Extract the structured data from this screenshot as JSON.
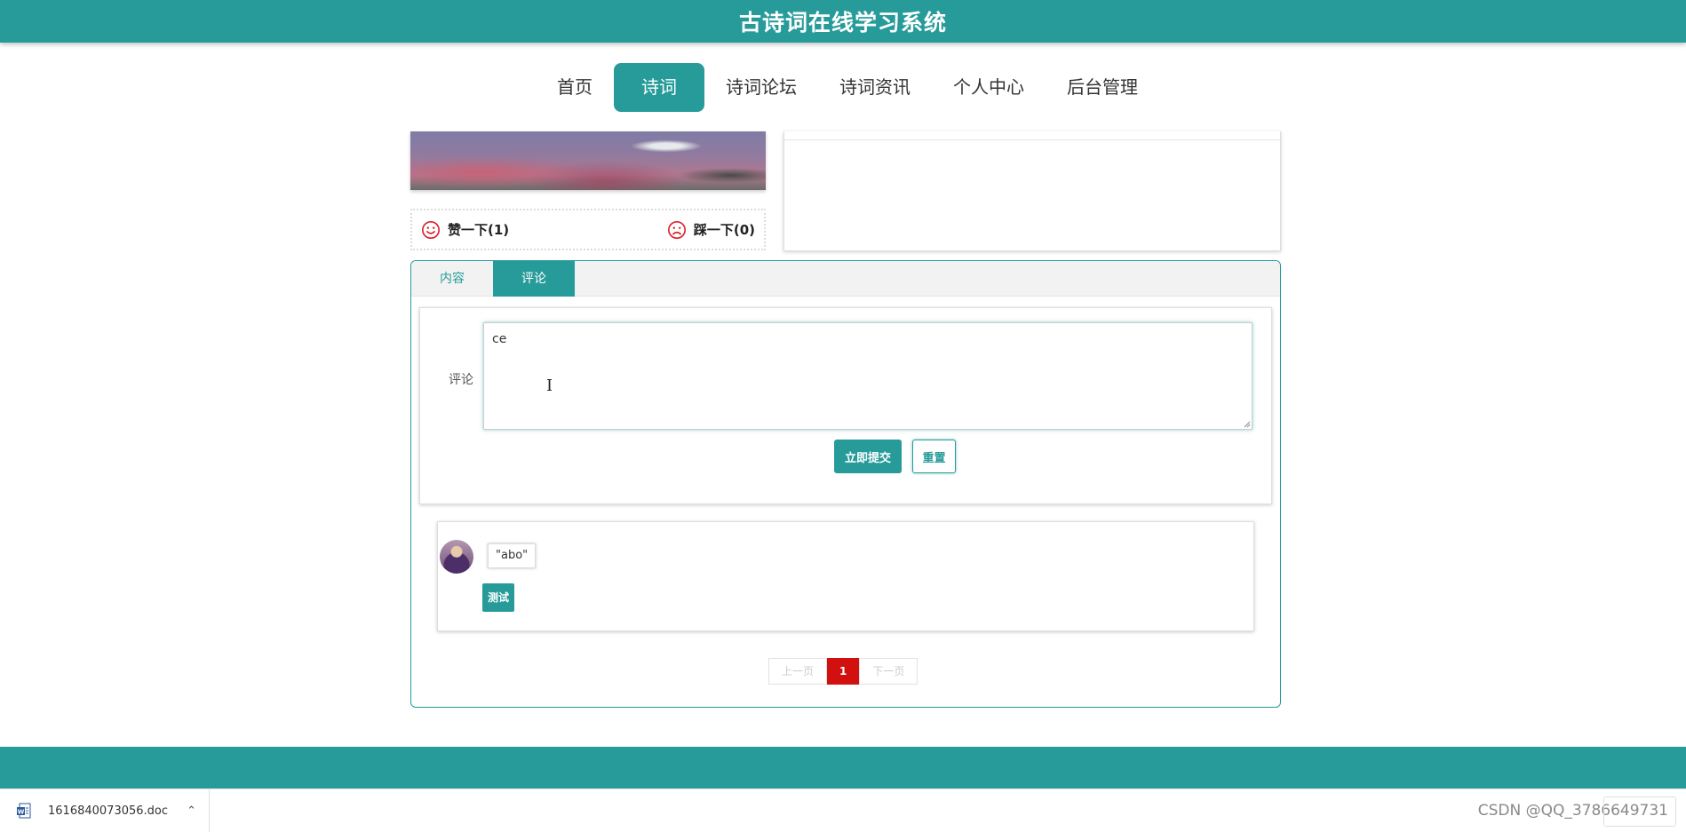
{
  "header": {
    "title": "古诗词在线学习系统"
  },
  "nav": {
    "items": [
      {
        "label": "首页"
      },
      {
        "label": "诗词"
      },
      {
        "label": "诗词论坛"
      },
      {
        "label": "诗词资讯"
      },
      {
        "label": "个人中心"
      },
      {
        "label": "后台管理"
      }
    ],
    "active": "诗词"
  },
  "votes": {
    "like_label": "赞一下(1)",
    "dislike_label": "踩一下(0)",
    "like_icon": "smile-icon",
    "dislike_icon": "frown-icon",
    "icon_color": "#d9232f"
  },
  "tabs": [
    {
      "label": "内容"
    },
    {
      "label": "评论"
    }
  ],
  "comment_form": {
    "label": "评论",
    "value": "ce",
    "submit_label": "立即提交",
    "reset_label": "重置"
  },
  "comments": [
    {
      "user": "\"abo\"",
      "content": "测试"
    }
  ],
  "pagination": {
    "prev_label": "上一页",
    "current": "1",
    "next_label": "下一页"
  },
  "download_bar": {
    "file_name": "1616840073056.doc",
    "watermark": "CSDN @QQ_3786649731"
  },
  "colors": {
    "primary": "#279b9a",
    "page_active": "#d31010"
  }
}
